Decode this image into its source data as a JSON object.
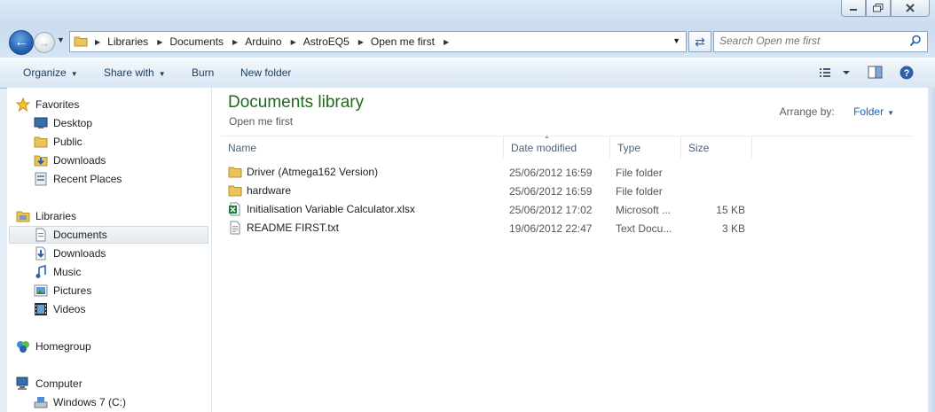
{
  "window": {
    "controls": [
      "minimize-icon",
      "maximize-icon",
      "close-icon"
    ]
  },
  "nav": {
    "breadcrumbs": [
      "Libraries",
      "Documents",
      "Arduino",
      "AstroEQ5",
      "Open me first"
    ],
    "search_placeholder": "Search Open me first"
  },
  "toolbar": {
    "organize": "Organize",
    "share_with": "Share with",
    "burn": "Burn",
    "new_folder": "New folder"
  },
  "sidebar": {
    "favorites": {
      "label": "Favorites",
      "items": [
        "Desktop",
        "Public",
        "Downloads",
        "Recent Places"
      ]
    },
    "libraries": {
      "label": "Libraries",
      "items": [
        "Documents",
        "Downloads",
        "Music",
        "Pictures",
        "Videos"
      ]
    },
    "selected": "Documents",
    "homegroup": "Homegroup",
    "computer": {
      "label": "Computer",
      "items": [
        "Windows 7 (C:)"
      ]
    }
  },
  "main": {
    "title": "Documents library",
    "subtitle": "Open me first",
    "arrange_by_label": "Arrange by:",
    "arrange_by_value": "Folder",
    "columns": [
      "Name",
      "Date modified",
      "Type",
      "Size"
    ],
    "files": [
      {
        "name": "Driver (Atmega162 Version)",
        "date": "25/06/2012 16:59",
        "type": "File folder",
        "size": "",
        "icon": "folder-icon"
      },
      {
        "name": "hardware",
        "date": "25/06/2012 16:59",
        "type": "File folder",
        "size": "",
        "icon": "folder-icon"
      },
      {
        "name": "Initialisation Variable Calculator.xlsx",
        "date": "25/06/2012 17:02",
        "type": "Microsoft ...",
        "size": "15 KB",
        "icon": "excel-file-icon"
      },
      {
        "name": "README FIRST.txt",
        "date": "19/06/2012 22:47",
        "type": "Text Docu...",
        "size": "3 KB",
        "icon": "text-file-icon"
      }
    ]
  },
  "colors": {
    "library_title": "#1e6a1e",
    "link_blue": "#1f5fb0",
    "selection_bg": "#e6eaee"
  }
}
